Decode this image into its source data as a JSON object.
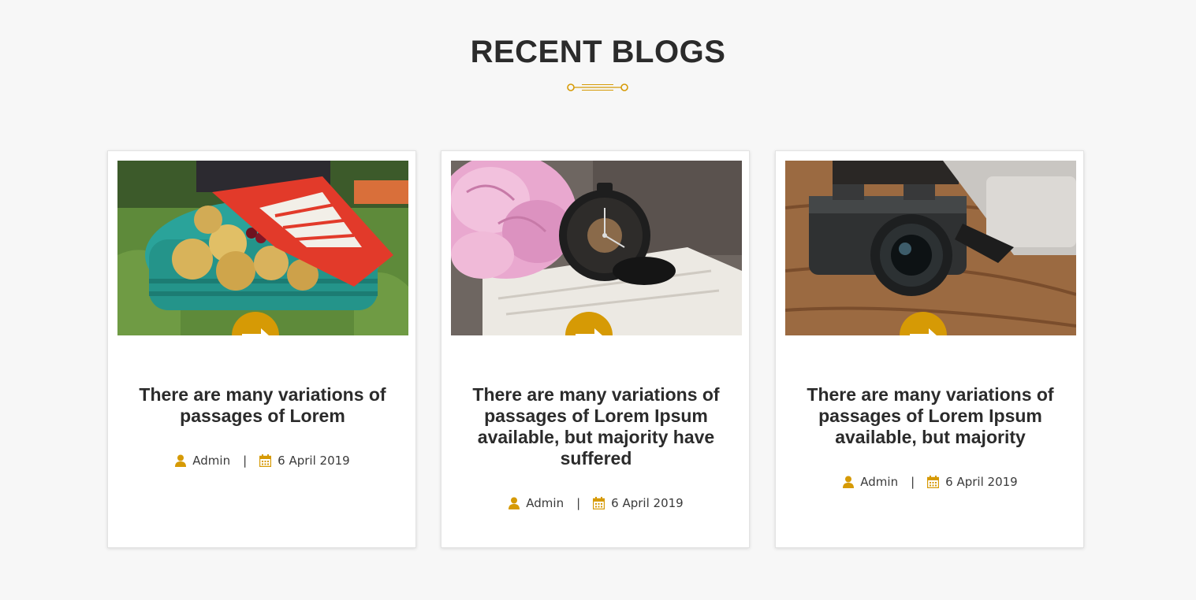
{
  "section": {
    "title": "RECENT BLOGS",
    "accent_color": "#d69a05"
  },
  "posts": [
    {
      "image": "muffins-basket-image",
      "title": "There are many variations of passages of Lorem",
      "author": "Admin",
      "separator": "|",
      "date": "6 April 2019",
      "author_icon": "user-icon",
      "date_icon": "calendar-icon",
      "read_more_icon": "arrow-right-icon"
    },
    {
      "image": "pocket-watch-flowers-image",
      "title": "There are many variations of passages of Lorem Ipsum available, but majority have suffered",
      "author": "Admin",
      "separator": "|",
      "date": "6 April 2019",
      "author_icon": "user-icon",
      "date_icon": "calendar-icon",
      "read_more_icon": "arrow-right-icon"
    },
    {
      "image": "vintage-camera-image",
      "title": "There are many variations of passages of Lorem Ipsum available, but majority",
      "author": "Admin",
      "separator": "|",
      "date": "6 April 2019",
      "author_icon": "user-icon",
      "date_icon": "calendar-icon",
      "read_more_icon": "arrow-right-icon"
    }
  ]
}
